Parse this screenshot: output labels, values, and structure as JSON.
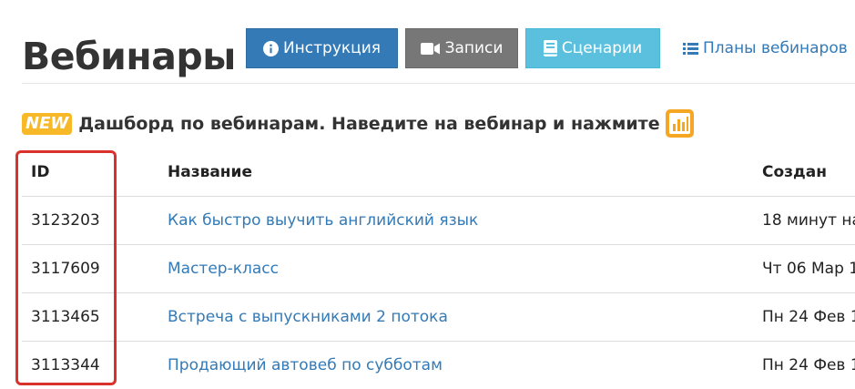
{
  "header": {
    "title": "Вебинары"
  },
  "toolbar": {
    "instruction_label": "Инструкция",
    "records_label": "Записи",
    "scenarios_label": "Сценарии",
    "plans_label": "Планы вебинаров"
  },
  "notice": {
    "badge": "NEW",
    "text": "Дашборд по вебинарам. Наведите на вебинар и нажмите"
  },
  "table": {
    "columns": [
      "ID",
      "Название",
      "Создан"
    ],
    "rows": [
      {
        "id": "3123203",
        "name": "Как быстро выучить английский язык",
        "created": "18 минут на"
      },
      {
        "id": "3117609",
        "name": "Мастер-класс",
        "created": "Чт 06 Мар 1"
      },
      {
        "id": "3113465",
        "name": "Встреча с выпускниками 2 потока",
        "created": "Пн 24 Фев 1"
      },
      {
        "id": "3113344",
        "name": "Продающий автовеб по субботам",
        "created": "Пн 24 Фев 1"
      }
    ]
  },
  "colors": {
    "primary": "#337ab7",
    "default_gray": "#777777",
    "info": "#5bc0de",
    "badge": "#f7b928",
    "highlight": "#d9322c"
  },
  "icons": {
    "instruction": "info-circle-icon",
    "records": "video-camera-icon",
    "scenarios": "book-icon",
    "plans": "list-icon",
    "dashboard": "bar-chart-icon"
  }
}
